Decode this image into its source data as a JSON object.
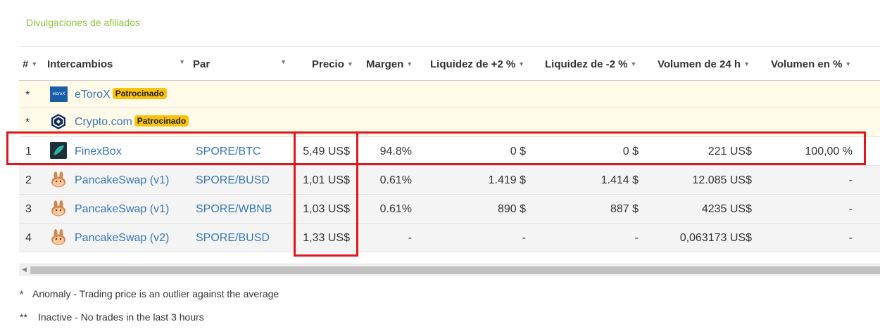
{
  "section_title": "Divulgaciones de afiliados",
  "headers": {
    "num": "#",
    "exchange": "Intercambios",
    "pair": "Par",
    "price": "Precio",
    "spread": "Margen",
    "depth_plus": "Liquidez de +2 %",
    "depth_minus": "Liquidez de -2 %",
    "volume24": "Volumen de 24 h",
    "volume_pct": "Volumen en %"
  },
  "sponsored_label": "Patrocinado",
  "sponsored": [
    {
      "mark": "*",
      "name": "eToroX",
      "logo_text": "etoroX"
    },
    {
      "mark": "*",
      "name": "Crypto.com"
    }
  ],
  "rows": [
    {
      "num": "1",
      "name": "FinexBox",
      "pair": "SPORE/BTC",
      "price": "5,49 US$",
      "spread": "94.8%",
      "depth_plus": "0 $",
      "depth_minus": "0 $",
      "volume24": "221 US$",
      "volume_pct": "100,00 %"
    },
    {
      "num": "2",
      "name": "PancakeSwap (v1)",
      "pair": "SPORE/BUSD",
      "price": "1,01 US$",
      "spread": "0.61%",
      "depth_plus": "1.419 $",
      "depth_minus": "1.414 $",
      "volume24": "12.085 US$",
      "volume_pct": "-"
    },
    {
      "num": "3",
      "name": "PancakeSwap (v1)",
      "pair": "SPORE/WBNB",
      "price": "1,03 US$",
      "spread": "0.61%",
      "depth_plus": "890 $",
      "depth_minus": "887 $",
      "volume24": "4235 US$",
      "volume_pct": "-"
    },
    {
      "num": "4",
      "name": "PancakeSwap (v2)",
      "pair": "SPORE/BUSD",
      "price": "1,33 US$",
      "spread": "-",
      "depth_plus": "-",
      "depth_minus": "-",
      "volume24": "0,063173 US$",
      "volume_pct": "-"
    }
  ],
  "notes": [
    {
      "mark": "*",
      "text": "Anomaly - Trading price is an outlier against the average"
    },
    {
      "mark": "**",
      "text": "Inactive - No trades in the last 3 hours"
    }
  ],
  "colors": {
    "accent_green": "#8dc63f",
    "link_blue": "#3777b6",
    "badge_yellow": "#f8c20e",
    "highlight_red": "#e0161e"
  }
}
